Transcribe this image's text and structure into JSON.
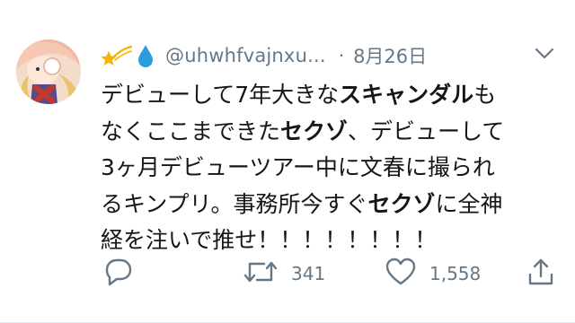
{
  "tweet": {
    "avatar_icon": "anime-avatar-icon",
    "name_emojis": [
      "shooting-star-icon",
      "droplet-icon"
    ],
    "handle": "@uhwhfvajnxu...",
    "separator": "·",
    "date": "8月26日",
    "menu_icon": "chevron-down-icon",
    "text_lines": [
      [
        {
          "t": "デビューして7年大きな",
          "b": false
        },
        {
          "t": "スキャンダル",
          "b": true
        },
        {
          "t": "も",
          "b": false
        }
      ],
      [
        {
          "t": "なくここまできた",
          "b": false
        },
        {
          "t": "セクゾ",
          "b": true
        },
        {
          "t": "、デビューして",
          "b": false
        }
      ],
      [
        {
          "t": "3ヶ月デビューツアー中に文春に撮られ",
          "b": false
        }
      ],
      [
        {
          "t": "るキンプリ。事務所今すぐ",
          "b": false
        },
        {
          "t": "セクゾ",
          "b": true
        },
        {
          "t": "に全神",
          "b": false
        }
      ],
      [
        {
          "t": "経を注いで推せ！！！！！！！！",
          "b": false
        }
      ]
    ],
    "actions": {
      "reply": {
        "icon": "reply-icon",
        "count": ""
      },
      "retweet": {
        "icon": "retweet-icon",
        "count": "341"
      },
      "like": {
        "icon": "heart-icon",
        "count": "1,558"
      },
      "share": {
        "icon": "share-icon",
        "count": ""
      }
    },
    "colors": {
      "text": "#14171a",
      "secondary": "#657786",
      "background": "#ffffff"
    }
  }
}
